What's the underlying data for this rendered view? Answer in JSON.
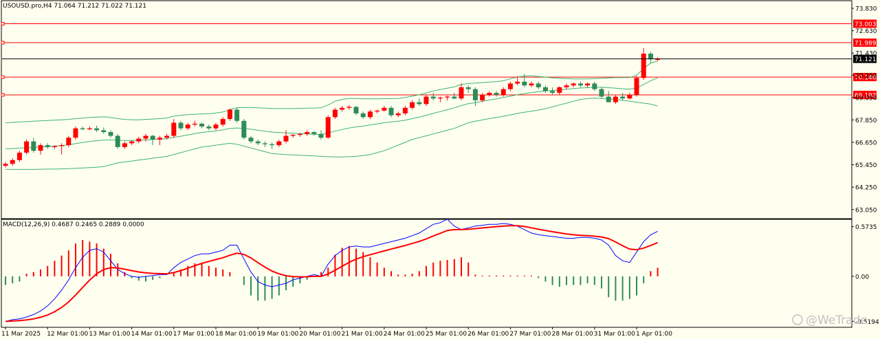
{
  "chart_data": {
    "type": "candlestick",
    "symbol_header": "USOUSD.pro,H4  71.064 71.212 71.022 71.121",
    "price_axis": {
      "ylim": [
        62.6,
        74.2
      ],
      "ticks": [
        "73.830",
        "72.630",
        "71.430",
        "70.250",
        "69.050",
        "67.850",
        "66.650",
        "65.450",
        "64.250",
        "63.050"
      ],
      "current_price": "71.121"
    },
    "levels": [
      {
        "label": "73.003",
        "value": 73.003
      },
      {
        "label": "71.989",
        "value": 71.989
      },
      {
        "label": "70.146",
        "value": 70.146
      },
      {
        "label": "69.192",
        "value": 69.192
      }
    ],
    "candles": [
      [
        65.4,
        65.6,
        65.3,
        65.5
      ],
      [
        65.5,
        65.8,
        65.4,
        65.7
      ],
      [
        65.7,
        66.2,
        65.6,
        66.1
      ],
      [
        66.1,
        66.8,
        66.0,
        66.7
      ],
      [
        66.7,
        66.9,
        66.1,
        66.2
      ],
      [
        66.2,
        66.6,
        66.0,
        66.5
      ],
      [
        66.5,
        66.6,
        66.3,
        66.4
      ],
      [
        66.4,
        66.5,
        66.3,
        66.45
      ],
      [
        66.45,
        66.6,
        66.0,
        66.5
      ],
      [
        66.5,
        67.0,
        66.4,
        66.9
      ],
      [
        66.9,
        67.5,
        66.8,
        67.4
      ],
      [
        67.4,
        67.5,
        67.3,
        67.35
      ],
      [
        67.35,
        67.5,
        67.3,
        67.4
      ],
      [
        67.4,
        67.55,
        67.2,
        67.3
      ],
      [
        67.3,
        67.45,
        67.1,
        67.2
      ],
      [
        67.2,
        67.3,
        66.9,
        67.0
      ],
      [
        67.0,
        67.1,
        66.3,
        66.4
      ],
      [
        66.4,
        66.7,
        66.3,
        66.6
      ],
      [
        66.6,
        66.75,
        66.5,
        66.7
      ],
      [
        66.7,
        66.95,
        66.6,
        66.85
      ],
      [
        66.85,
        67.1,
        66.7,
        67.0
      ],
      [
        67.0,
        67.05,
        66.5,
        66.8
      ],
      [
        66.8,
        67.0,
        66.5,
        66.9
      ],
      [
        66.9,
        67.1,
        66.8,
        67.0
      ],
      [
        67.0,
        67.9,
        66.9,
        67.7
      ],
      [
        67.7,
        67.8,
        67.3,
        67.4
      ],
      [
        67.4,
        67.7,
        67.3,
        67.6
      ],
      [
        67.6,
        67.8,
        67.5,
        67.65
      ],
      [
        67.65,
        67.7,
        67.4,
        67.5
      ],
      [
        67.5,
        67.6,
        67.3,
        67.4
      ],
      [
        67.4,
        67.7,
        67.3,
        67.6
      ],
      [
        67.6,
        68.0,
        67.5,
        67.9
      ],
      [
        67.9,
        68.45,
        67.8,
        68.4
      ],
      [
        68.4,
        68.5,
        67.7,
        67.8
      ],
      [
        67.8,
        67.9,
        66.8,
        66.9
      ],
      [
        66.9,
        67.0,
        66.6,
        66.7
      ],
      [
        66.7,
        66.8,
        66.5,
        66.6
      ],
      [
        66.6,
        66.7,
        66.4,
        66.55
      ],
      [
        66.55,
        66.65,
        66.3,
        66.5
      ],
      [
        66.5,
        66.8,
        66.4,
        66.7
      ],
      [
        66.7,
        67.3,
        66.6,
        67.0
      ],
      [
        67.0,
        67.1,
        66.9,
        67.05
      ],
      [
        67.05,
        67.15,
        66.95,
        67.1
      ],
      [
        67.1,
        67.3,
        67.0,
        67.2
      ],
      [
        67.2,
        67.25,
        67.0,
        67.1
      ],
      [
        67.1,
        67.3,
        66.8,
        66.9
      ],
      [
        66.9,
        68.1,
        66.85,
        68.0
      ],
      [
        68.0,
        68.5,
        67.9,
        68.4
      ],
      [
        68.4,
        68.6,
        68.3,
        68.5
      ],
      [
        68.5,
        68.65,
        68.4,
        68.55
      ],
      [
        68.55,
        68.6,
        68.1,
        68.2
      ],
      [
        68.2,
        68.3,
        67.9,
        68.0
      ],
      [
        68.0,
        68.4,
        67.9,
        68.3
      ],
      [
        68.3,
        68.4,
        68.2,
        68.35
      ],
      [
        68.35,
        68.6,
        68.3,
        68.5
      ],
      [
        68.5,
        68.6,
        68.0,
        68.1
      ],
      [
        68.1,
        68.3,
        68.0,
        68.2
      ],
      [
        68.2,
        68.6,
        68.1,
        68.5
      ],
      [
        68.5,
        68.9,
        68.4,
        68.8
      ],
      [
        68.8,
        69.0,
        68.6,
        68.7
      ],
      [
        68.7,
        69.2,
        68.6,
        69.1
      ],
      [
        69.1,
        69.3,
        68.9,
        69.0
      ],
      [
        69.0,
        69.1,
        68.8,
        69.05
      ],
      [
        69.05,
        69.15,
        68.9,
        69.1
      ],
      [
        69.1,
        69.3,
        68.95,
        69.0
      ],
      [
        69.0,
        69.8,
        68.9,
        69.6
      ],
      [
        69.6,
        69.7,
        69.3,
        69.5
      ],
      [
        69.5,
        69.6,
        68.6,
        68.9
      ],
      [
        68.9,
        69.3,
        68.8,
        69.2
      ],
      [
        69.2,
        69.4,
        69.1,
        69.3
      ],
      [
        69.3,
        69.4,
        69.1,
        69.2
      ],
      [
        69.2,
        69.6,
        69.1,
        69.5
      ],
      [
        69.5,
        69.9,
        69.4,
        69.8
      ],
      [
        69.8,
        70.2,
        69.7,
        69.9
      ],
      [
        69.9,
        70.3,
        69.6,
        69.7
      ],
      [
        69.7,
        69.9,
        69.6,
        69.8
      ],
      [
        69.8,
        69.9,
        69.5,
        69.6
      ],
      [
        69.6,
        69.7,
        69.3,
        69.4
      ],
      [
        69.4,
        69.6,
        69.2,
        69.3
      ],
      [
        69.3,
        69.65,
        69.2,
        69.6
      ],
      [
        69.6,
        69.8,
        69.5,
        69.7
      ],
      [
        69.7,
        69.85,
        69.6,
        69.8
      ],
      [
        69.8,
        69.9,
        69.6,
        69.7
      ],
      [
        69.7,
        69.85,
        69.6,
        69.8
      ],
      [
        69.8,
        69.9,
        69.4,
        69.5
      ],
      [
        69.5,
        69.6,
        69.0,
        69.1
      ],
      [
        69.1,
        69.4,
        68.9,
        68.8
      ],
      [
        68.8,
        69.2,
        68.7,
        69.1
      ],
      [
        69.1,
        69.3,
        68.9,
        69.0
      ],
      [
        69.0,
        69.3,
        68.95,
        69.2
      ],
      [
        69.2,
        70.2,
        69.1,
        70.1
      ],
      [
        70.1,
        71.7,
        70.0,
        71.4
      ],
      [
        71.4,
        71.5,
        70.9,
        71.1
      ],
      [
        71.064,
        71.212,
        71.022,
        71.121
      ]
    ],
    "bollinger": {
      "upper": [
        67.7,
        67.72,
        67.74,
        67.76,
        67.78,
        67.8,
        67.82,
        67.84,
        67.86,
        67.88,
        67.92,
        67.95,
        67.98,
        68.0,
        68.02,
        67.98,
        67.92,
        67.88,
        67.86,
        67.86,
        67.88,
        67.9,
        67.92,
        67.95,
        68.05,
        68.1,
        68.13,
        68.15,
        68.17,
        68.18,
        68.22,
        68.28,
        68.4,
        68.5,
        68.52,
        68.52,
        68.5,
        68.48,
        68.46,
        68.46,
        68.46,
        68.46,
        68.47,
        68.48,
        68.49,
        68.5,
        68.65,
        68.85,
        68.95,
        69.0,
        69.0,
        68.98,
        68.98,
        68.98,
        68.99,
        68.99,
        69.0,
        69.05,
        69.12,
        69.2,
        69.3,
        69.4,
        69.48,
        69.55,
        69.62,
        69.75,
        69.8,
        69.82,
        69.85,
        69.88,
        69.9,
        69.95,
        70.05,
        70.15,
        70.2,
        70.22,
        70.18,
        70.15,
        70.1,
        70.08,
        70.06,
        70.05,
        70.05,
        70.05,
        70.06,
        70.08,
        70.1,
        70.12,
        70.12,
        70.12,
        70.25,
        70.6,
        70.9,
        71.0
      ],
      "middle": [
        66.3,
        66.32,
        66.34,
        66.36,
        66.38,
        66.4,
        66.42,
        66.45,
        66.48,
        66.52,
        66.58,
        66.64,
        66.7,
        66.74,
        66.77,
        66.78,
        66.76,
        66.75,
        66.75,
        66.76,
        66.78,
        66.8,
        66.82,
        66.85,
        66.92,
        66.98,
        67.05,
        67.12,
        67.18,
        67.22,
        67.26,
        67.32,
        67.4,
        67.42,
        67.4,
        67.35,
        67.3,
        67.25,
        67.2,
        67.18,
        67.16,
        67.14,
        67.12,
        67.1,
        67.08,
        67.07,
        67.15,
        67.25,
        67.34,
        67.42,
        67.48,
        67.52,
        67.58,
        67.64,
        67.7,
        67.74,
        67.78,
        67.84,
        67.92,
        68.0,
        68.1,
        68.2,
        68.3,
        68.4,
        68.5,
        68.62,
        68.72,
        68.78,
        68.85,
        68.92,
        68.98,
        69.05,
        69.12,
        69.2,
        69.26,
        69.32,
        69.36,
        69.4,
        69.43,
        69.46,
        69.5,
        69.53,
        69.56,
        69.58,
        69.6,
        69.6,
        69.58,
        69.55,
        69.52,
        69.5,
        69.55,
        69.75,
        69.95,
        70.1
      ],
      "lower": [
        65.2,
        65.2,
        65.2,
        65.2,
        65.2,
        65.21,
        65.22,
        65.22,
        65.23,
        65.24,
        65.26,
        65.28,
        65.3,
        65.32,
        65.35,
        65.45,
        65.55,
        65.6,
        65.65,
        65.7,
        65.75,
        65.8,
        65.85,
        65.9,
        66.0,
        66.1,
        66.2,
        66.3,
        66.4,
        66.45,
        66.5,
        66.55,
        66.6,
        66.55,
        66.45,
        66.35,
        66.25,
        66.15,
        66.05,
        66.02,
        66.0,
        65.98,
        65.96,
        65.94,
        65.92,
        65.9,
        65.88,
        65.87,
        65.87,
        65.88,
        65.9,
        65.94,
        66.0,
        66.1,
        66.2,
        66.35,
        66.5,
        66.65,
        66.8,
        66.9,
        67.0,
        67.1,
        67.2,
        67.3,
        67.4,
        67.55,
        67.7,
        67.78,
        67.85,
        67.92,
        67.98,
        68.05,
        68.12,
        68.2,
        68.26,
        68.32,
        68.38,
        68.45,
        68.55,
        68.65,
        68.75,
        68.85,
        68.95,
        69.0,
        69.02,
        69.0,
        68.98,
        68.95,
        68.9,
        68.85,
        68.8,
        68.75,
        68.7,
        68.6
      ]
    },
    "macd": {
      "header": "MACD(12,26,9) 0.4687 0.2465 0.2889 0.0000",
      "ylim": [
        -0.58,
        0.65
      ],
      "ticks": [
        "0.5735",
        "0.00",
        "-0.5194"
      ],
      "histogram": [
        -0.1,
        -0.08,
        -0.06,
        0.03,
        0.05,
        0.08,
        0.12,
        0.18,
        0.24,
        0.3,
        0.38,
        0.42,
        0.4,
        0.38,
        0.32,
        0.26,
        0.15,
        0.05,
        -0.02,
        -0.05,
        -0.06,
        -0.04,
        -0.02,
        0.0,
        0.05,
        0.08,
        0.12,
        0.15,
        0.15,
        0.12,
        0.1,
        0.08,
        0.05,
        0.0,
        -0.1,
        -0.22,
        -0.28,
        -0.28,
        -0.26,
        -0.22,
        -0.16,
        -0.12,
        -0.08,
        -0.04,
        0.0,
        0.05,
        0.1,
        0.25,
        0.33,
        0.35,
        0.32,
        0.28,
        0.22,
        0.16,
        0.1,
        0.06,
        0.02,
        0.02,
        0.03,
        0.06,
        0.12,
        0.16,
        0.18,
        0.19,
        0.2,
        0.22,
        0.16,
        0.02,
        0.01,
        0.01,
        0.01,
        0.01,
        0.01,
        0.01,
        0.01,
        0.01,
        -0.02,
        -0.06,
        -0.1,
        -0.12,
        -0.1,
        -0.1,
        -0.1,
        -0.08,
        -0.1,
        -0.14,
        -0.24,
        -0.28,
        -0.28,
        -0.26,
        -0.22,
        -0.08,
        0.06,
        0.1
      ],
      "macd_line": [
        -0.52,
        -0.5,
        -0.49,
        -0.47,
        -0.44,
        -0.4,
        -0.34,
        -0.26,
        -0.16,
        -0.04,
        0.1,
        0.22,
        0.3,
        0.32,
        0.28,
        0.18,
        0.08,
        0.03,
        0.0,
        -0.01,
        0.0,
        0.01,
        0.02,
        0.02,
        0.1,
        0.16,
        0.2,
        0.24,
        0.26,
        0.26,
        0.28,
        0.3,
        0.36,
        0.36,
        0.2,
        0.05,
        -0.06,
        -0.1,
        -0.12,
        -0.1,
        -0.08,
        -0.04,
        -0.02,
        0.0,
        0.02,
        0.0,
        0.14,
        0.24,
        0.3,
        0.34,
        0.35,
        0.34,
        0.34,
        0.36,
        0.38,
        0.4,
        0.42,
        0.44,
        0.47,
        0.5,
        0.55,
        0.6,
        0.62,
        0.66,
        0.58,
        0.54,
        0.56,
        0.58,
        0.59,
        0.6,
        0.6,
        0.61,
        0.6,
        0.58,
        0.54,
        0.5,
        0.48,
        0.47,
        0.46,
        0.45,
        0.44,
        0.44,
        0.45,
        0.45,
        0.44,
        0.42,
        0.36,
        0.24,
        0.18,
        0.16,
        0.28,
        0.4,
        0.48,
        0.52
      ]
    },
    "time_axis": {
      "labels": [
        {
          "text": "11 Mar 2025",
          "index": 0
        },
        {
          "text": "12 Mar 01:00",
          "index": 6
        },
        {
          "text": "13 Mar 01:00",
          "index": 12
        },
        {
          "text": "14 Mar 01:00",
          "index": 18
        },
        {
          "text": "17 Mar 01:00",
          "index": 24
        },
        {
          "text": "18 Mar 01:00",
          "index": 30
        },
        {
          "text": "19 Mar 01:00",
          "index": 36
        },
        {
          "text": "20 Mar 01:00",
          "index": 42
        },
        {
          "text": "21 Mar 01:00",
          "index": 48
        },
        {
          "text": "24 Mar 01:00",
          "index": 54
        },
        {
          "text": "25 Mar 01:00",
          "index": 60
        },
        {
          "text": "26 Mar 01:00",
          "index": 66
        },
        {
          "text": "27 Mar 01:00",
          "index": 72
        },
        {
          "text": "28 Mar 01:00",
          "index": 78
        },
        {
          "text": "31 Mar 01:00",
          "index": 84
        },
        {
          "text": "1 Apr 01:00",
          "index": 90
        }
      ]
    },
    "colors": {
      "up": "#ff0000",
      "down": "#2e8b57",
      "level_line": "#ff0000",
      "bollinger": "#3cb371",
      "macd_line": "#0000ff",
      "signal_line": "#ff0000",
      "price_line": "#000000"
    }
  },
  "watermark": "@WeTrade"
}
